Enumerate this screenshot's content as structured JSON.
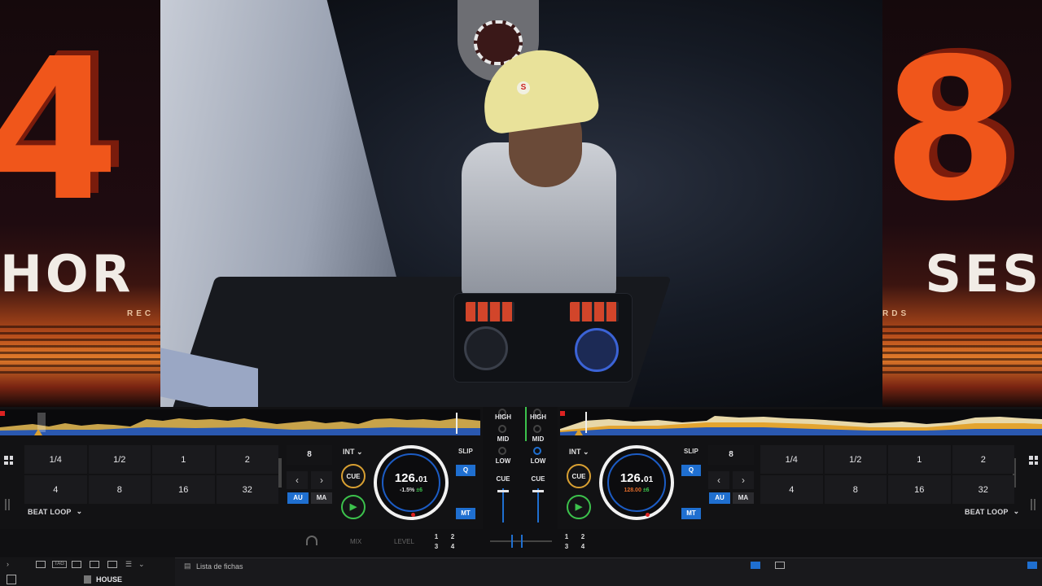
{
  "banner": {
    "left_glyph": "4",
    "left_word": "HOR",
    "left_small": "REC",
    "right_glyph": "8",
    "right_word": "SES",
    "right_small": "RDS"
  },
  "cam": {
    "cap_letter": "S"
  },
  "colors": {
    "accent_blue": "#1f6fd0",
    "cue_orange": "#d9a032",
    "play_green": "#3cc24c",
    "banner_orange": "#f0561b"
  },
  "deck_left": {
    "pads": [
      "1/4",
      "1/2",
      "1",
      "2",
      "4",
      "8",
      "16",
      "32"
    ],
    "beatloop_label": "BEAT LOOP",
    "loop_size": "8",
    "prev_arrow": "‹",
    "next_arrow": "›",
    "au_label": "AU",
    "ma_label": "MA",
    "int_label": "INT",
    "cue_label": "CUE",
    "play_label": "▶",
    "bpm_main": "126.",
    "bpm_dec": "01",
    "pitch": "-1.5%",
    "pitch_range": "±6",
    "slip_label": "SLIP",
    "q_label": "Q",
    "mt_label": "MT"
  },
  "deck_right": {
    "pads": [
      "1/4",
      "1/2",
      "1",
      "2",
      "4",
      "8",
      "16",
      "32"
    ],
    "beatloop_label": "BEAT LOOP",
    "loop_size": "8",
    "prev_arrow": "‹",
    "next_arrow": "›",
    "au_label": "AU",
    "ma_label": "MA",
    "int_label": "INT",
    "cue_label": "CUE",
    "play_label": "▶",
    "bpm_main": "126.",
    "bpm_dec": "01",
    "pitch": "128.00",
    "pitch_range": "±6",
    "slip_label": "SLIP",
    "q_label": "Q",
    "mt_label": "MT"
  },
  "mixer": {
    "high": "HIGH",
    "mid": "MID",
    "low": "LOW",
    "cue": "CUE",
    "mix_label": "MIX",
    "level_label": "LEVEL",
    "fx_left": [
      "1",
      "2",
      "3",
      "4"
    ],
    "fx_right": [
      "1",
      "2",
      "3",
      "4"
    ]
  },
  "browser": {
    "tag_label": "TAG",
    "folder": "HOUSE",
    "tab": "Lista de fichas"
  }
}
